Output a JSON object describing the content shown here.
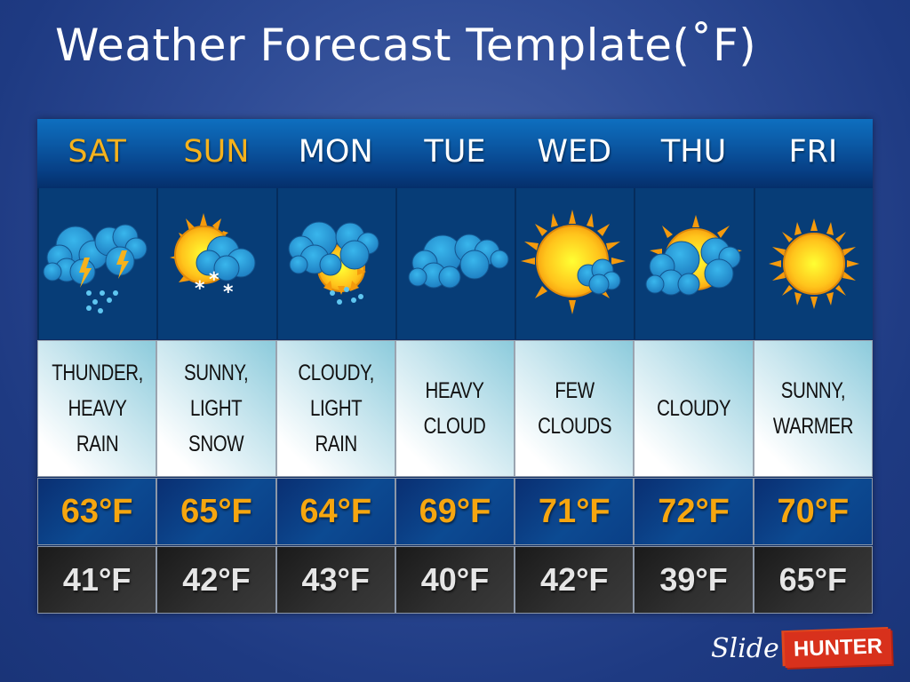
{
  "title": "Weather Forecast Template(˚F)",
  "colors": {
    "accent_day": "#f6b21c",
    "high_temp": "#f6a60f",
    "low_temp": "#e6e6e6",
    "header_blue": "#0b5aa6",
    "background": "#2f4c96"
  },
  "days": [
    {
      "label": "SAT",
      "accent": true,
      "icon": "thunder-heavy-rain-icon",
      "condition": "THUNDER,\nHEAVY\nRAIN",
      "high": "63°F",
      "low": "41°F"
    },
    {
      "label": "SUN",
      "accent": true,
      "icon": "sunny-light-snow-icon",
      "condition": "SUNNY,\nLIGHT\nSNOW",
      "high": "65°F",
      "low": "42°F"
    },
    {
      "label": "MON",
      "accent": false,
      "icon": "cloudy-light-rain-icon",
      "condition": "CLOUDY,\nLIGHT  RAIN",
      "high": "64°F",
      "low": "43°F"
    },
    {
      "label": "TUE",
      "accent": false,
      "icon": "heavy-cloud-icon",
      "condition": "HEAVY\nCLOUD",
      "high": "69°F",
      "low": "40°F"
    },
    {
      "label": "WED",
      "accent": false,
      "icon": "few-clouds-icon",
      "condition": "FEW\nCLOUDS",
      "high": "71°F",
      "low": "42°F"
    },
    {
      "label": "THU",
      "accent": false,
      "icon": "cloudy-icon",
      "condition": "CLOUDY",
      "high": "72°F",
      "low": "39°F"
    },
    {
      "label": "FRI",
      "accent": false,
      "icon": "sunny-icon",
      "condition": "SUNNY,\nWARMER",
      "high": "70°F",
      "low": "65°F"
    }
  ],
  "logo": {
    "part1": "Slide",
    "part2": "HUNTER"
  }
}
